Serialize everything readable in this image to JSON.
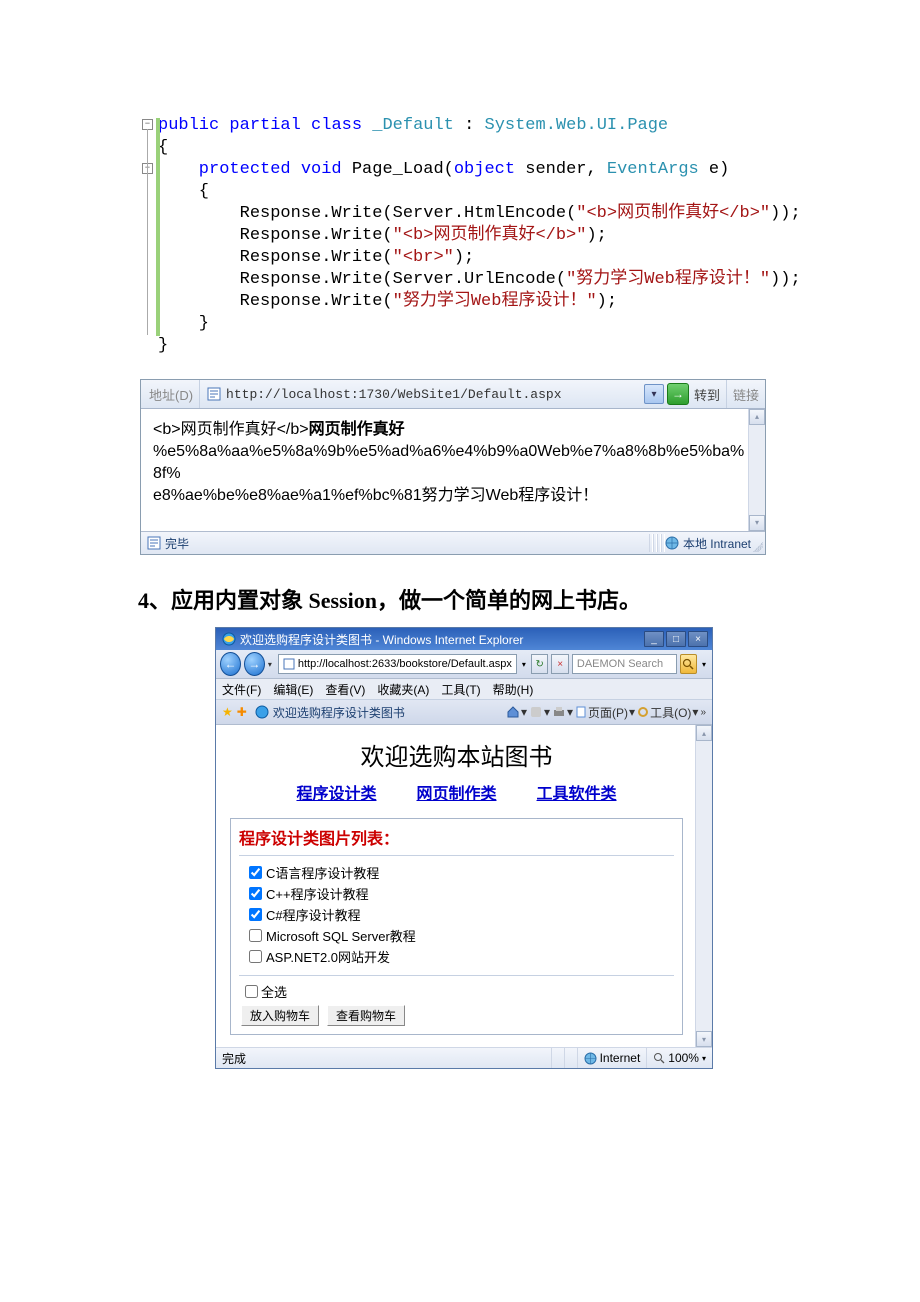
{
  "code": {
    "l1a": "public",
    "l1b": " partial",
    "l1c": " class",
    "l1d": " _Default",
    "l1e": " : ",
    "l1f": "System.Web.UI.Page",
    "l2": "{",
    "l3a": "    protected",
    "l3b": " void",
    "l3c": " Page_Load(",
    "l3d": "object",
    "l3e": " sender, ",
    "l3f": "EventArgs",
    "l3g": " e)",
    "l4": "    {",
    "l5a": "        Response.Write(Server.HtmlEncode(",
    "l5b": "\"<b>网页制作真好</b>\"",
    "l5c": "));",
    "l6a": "        Response.Write(",
    "l6b": "\"<b>网页制作真好</b>\"",
    "l6c": ");",
    "l7a": "        Response.Write(",
    "l7b": "\"<br>\"",
    "l7c": ");",
    "l8a": "        Response.Write(Server.UrlEncode(",
    "l8b": "\"努力学习Web程序设计！\"",
    "l8c": "));",
    "l9a": "        Response.Write(",
    "l9b": "\"努力学习Web程序设计！\"",
    "l9c": ");",
    "l10": "    }",
    "l11": "}"
  },
  "ie6": {
    "addr_label": "地址(D)",
    "url": "http://localhost:1730/WebSite1/Default.aspx",
    "goto": "转到",
    "links": "链接",
    "body_escaped": "<b>网页制作真好</b>",
    "body_bold": "网页制作真好",
    "body_line2a": "%e5%8a%aa%e5%8a%9b%e5%ad%a6%e4%b9%a0Web%e7%a8%8b%e5%ba%8f%",
    "body_line2b": "e8%ae%be%e8%ae%a1%ef%bc%81努力学习Web程序设计！",
    "status_left": "完毕",
    "status_right": "本地 Intranet"
  },
  "heading4": {
    "prefix": "4、应用内置对象 ",
    "session": "Session",
    "suffix": "，做一个简单的网上书店。"
  },
  "ie7": {
    "title": "欢迎选购程序设计类图书 - Windows Internet Explorer",
    "url": "http://localhost:2633/bookstore/Default.aspx",
    "search_ph": "DAEMON Search",
    "menu": {
      "file": "文件(F)",
      "edit": "编辑(E)",
      "view": "查看(V)",
      "fav": "收藏夹(A)",
      "tools": "工具(T)",
      "help": "帮助(H)"
    },
    "tab": "欢迎选购程序设计类图书",
    "toolbar": {
      "page": "页面(P)",
      "tools": "工具(O)"
    },
    "shop_title": "欢迎选购本站图书",
    "cats": {
      "c1": "程序设计类",
      "c2": "网页制作类",
      "c3": "工具软件类"
    },
    "panel_title": "程序设计类图片列表：",
    "books": {
      "b1": "C语言程序设计教程",
      "b2": "C++程序设计教程",
      "b3": "C#程序设计教程",
      "b4": "Microsoft SQL Server教程",
      "b5": "ASP.NET2.0网站开发"
    },
    "select_all": "全选",
    "btn_add": "放入购物车",
    "btn_view": "查看购物车",
    "status_done": "完成",
    "status_zone": "Internet",
    "status_zoom": "100%"
  }
}
